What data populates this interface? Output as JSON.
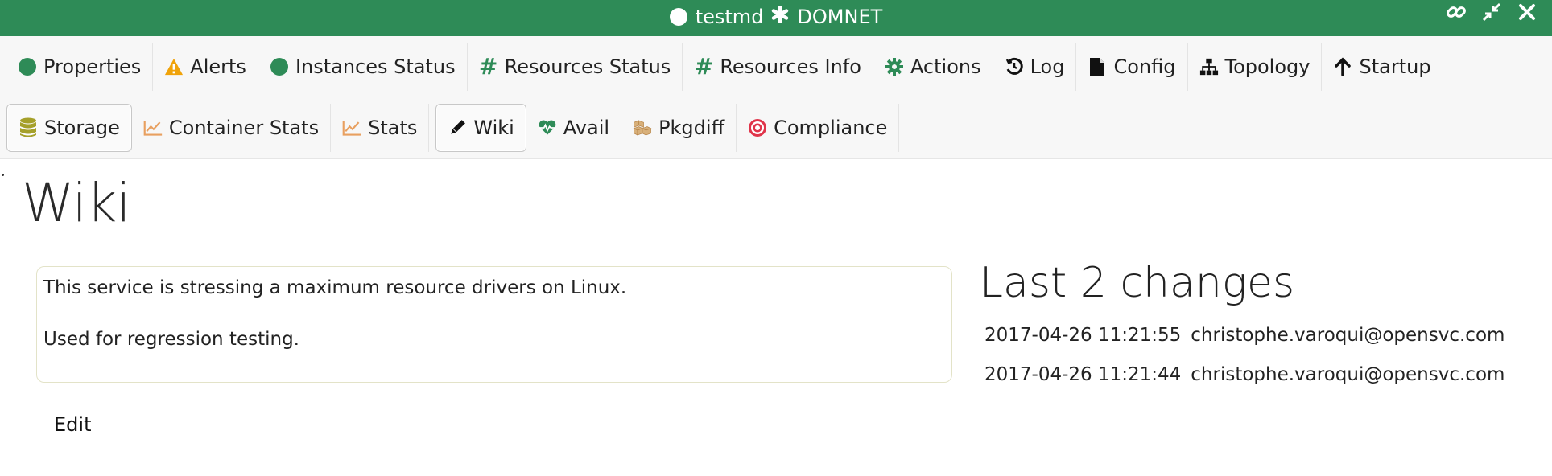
{
  "window": {
    "service": "testmd",
    "cluster": "DOMNET",
    "controls": [
      "link-icon",
      "compress-icon",
      "close-icon"
    ]
  },
  "tabs_row1": [
    {
      "label": "Properties",
      "icon": "circle-icon"
    },
    {
      "label": "Alerts",
      "icon": "warning-icon"
    },
    {
      "label": "Instances Status",
      "icon": "circle-icon"
    },
    {
      "label": "Resources Status",
      "icon": "hash-icon"
    },
    {
      "label": "Resources Info",
      "icon": "hash-icon"
    },
    {
      "label": "Actions",
      "icon": "gear-icon"
    },
    {
      "label": "Log",
      "icon": "history-icon"
    },
    {
      "label": "Config",
      "icon": "file-icon"
    },
    {
      "label": "Topology",
      "icon": "sitemap-icon"
    },
    {
      "label": "Startup",
      "icon": "arrow-up-icon"
    }
  ],
  "tabs_row2": [
    {
      "label": "Storage",
      "icon": "database-icon",
      "active": true
    },
    {
      "label": "Container Stats",
      "icon": "line-chart-icon"
    },
    {
      "label": "Stats",
      "icon": "line-chart-icon"
    },
    {
      "label": "Wiki",
      "icon": "pencil-icon",
      "active": true
    },
    {
      "label": "Avail",
      "icon": "heartbeat-icon"
    },
    {
      "label": "Pkgdiff",
      "icon": "cubes-icon"
    },
    {
      "label": "Compliance",
      "icon": "bullseye-icon"
    }
  ],
  "main": {
    "title": "Wiki",
    "content": [
      "This service is stressing a maximum resource drivers on Linux.",
      "Used for regression testing."
    ],
    "edit_label": "Edit"
  },
  "changes": {
    "title": "Last 2 changes",
    "entries": [
      {
        "date": "2017-04-26 11:21:55",
        "author": "christophe.varoqui@opensvc.com"
      },
      {
        "date": "2017-04-26 11:21:44",
        "author": "christophe.varoqui@opensvc.com"
      }
    ]
  },
  "colors": {
    "header_green": "#2e8b57",
    "warning": "#f0a30a",
    "chart_orange": "#e8a060",
    "storage_olive": "#a5a02a",
    "compliance_red": "#e0344a"
  }
}
